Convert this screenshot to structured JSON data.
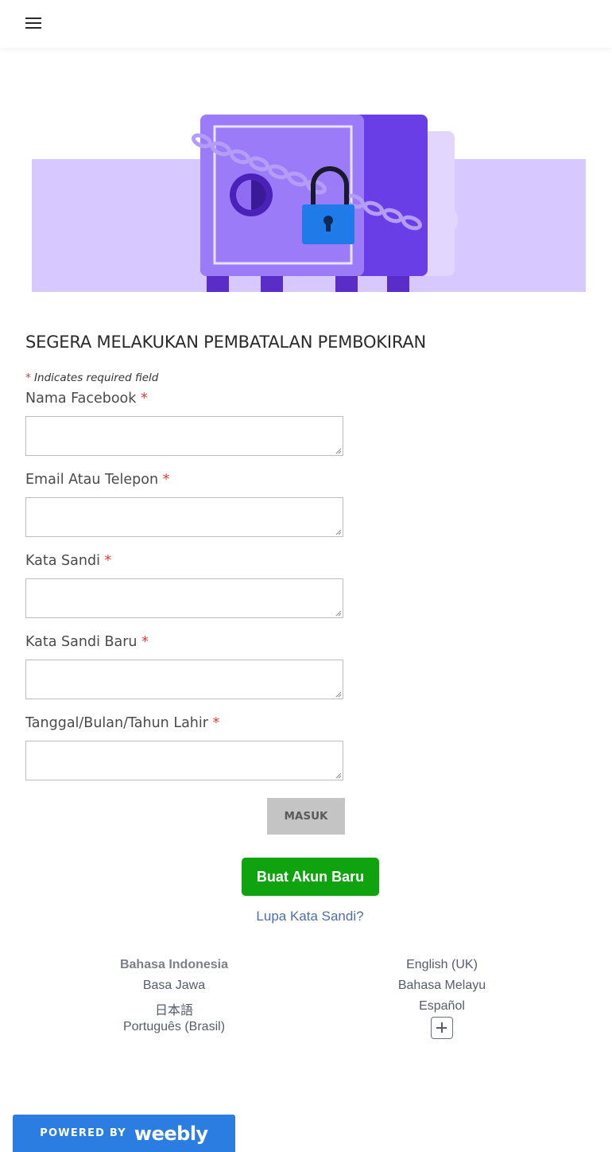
{
  "header": {
    "menu_icon": "hamburger-menu-icon"
  },
  "hero": {
    "illustration": "locked-safe-illustration",
    "colors": {
      "accent": "#7b4ff0",
      "light": "#d7c8ff",
      "lock": "#1f7be8"
    }
  },
  "form": {
    "title": "SEGERA MELAKUKAN PEMBATALAN PEMBOKIRAN",
    "required_star": "*",
    "required_note": "Indicates required field",
    "fields": [
      {
        "label": "Nama Facebook",
        "value": ""
      },
      {
        "label": "Email Atau Telepon",
        "value": ""
      },
      {
        "label": "Kata Sandi",
        "value": ""
      },
      {
        "label": "Kata Sandi Baru",
        "value": ""
      },
      {
        "label": "Tanggal/Bulan/Tahun Lahir",
        "value": ""
      }
    ],
    "submit_label": "MASUK"
  },
  "account": {
    "create_label": "Buat Akun Baru",
    "forgot_label": "Lupa Kata Sandi?"
  },
  "languages": {
    "left": [
      "Bahasa Indonesia",
      "Basa Jawa",
      "日本語",
      "Português (Brasil)"
    ],
    "right": [
      "English (UK)",
      "Bahasa Melayu",
      "Español"
    ],
    "more_icon": "plus-icon"
  },
  "footer": {
    "powered_by": "POWERED BY",
    "brand": "weebly",
    "colors": {
      "badge": "#2b7de1"
    }
  }
}
